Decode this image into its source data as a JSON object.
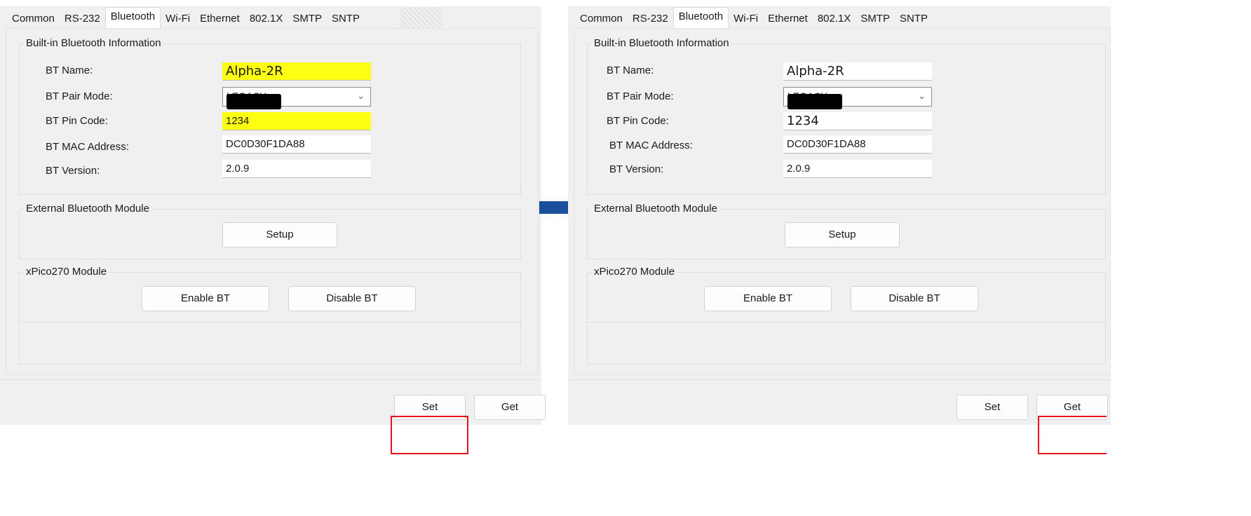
{
  "tabs": [
    "Common",
    "RS-232",
    "Bluetooth",
    "Wi-Fi",
    "Ethernet",
    "802.1X",
    "SMTP",
    "SNTP"
  ],
  "active_tab": "Bluetooth",
  "builtin": {
    "title": "Built-in Bluetooth Information",
    "labels": {
      "name": "BT Name:",
      "pair_mode": "BT Pair Mode:",
      "pin": "BT Pin Code:",
      "mac": "BT MAC Address:",
      "version": "BT Version:"
    },
    "values": {
      "name": "Alpha-2R",
      "pair_mode": "LEGACY",
      "pin": "1234",
      "mac": "DC0D30F1DA88",
      "version": "2.0.9"
    }
  },
  "external": {
    "title": "External Bluetooth Module",
    "setup_label": "Setup"
  },
  "xpico": {
    "title": "xPico270 Module",
    "enable_label": "Enable BT",
    "disable_label": "Disable BT"
  },
  "actions": {
    "set_label": "Set",
    "get_label": "Get"
  },
  "colors": {
    "highlight": "#ffff14",
    "red_box": "#e8141c",
    "arrow": "#1b4f9c"
  },
  "icons": {
    "dropdown": "chevron-down-icon",
    "arrow": "right-arrow-icon"
  }
}
